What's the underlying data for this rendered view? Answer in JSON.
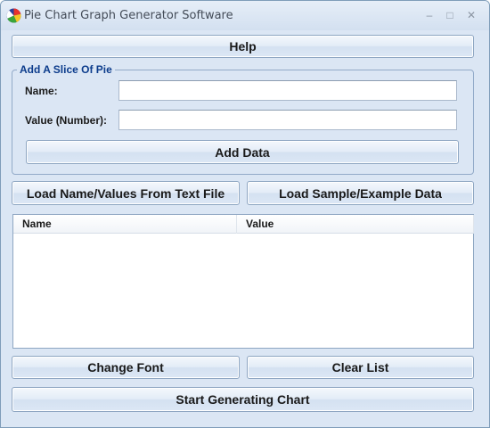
{
  "window": {
    "title": "Pie Chart Graph Generator Software",
    "controls": {
      "minimize": "–",
      "maximize": "□",
      "close": "✕"
    }
  },
  "buttons": {
    "help": "Help",
    "add_data": "Add Data",
    "load_file": "Load Name/Values From Text File",
    "load_sample": "Load Sample/Example Data",
    "change_font": "Change Font",
    "clear_list": "Clear List",
    "start": "Start Generating Chart"
  },
  "add_slice": {
    "legend": "Add A Slice Of Pie",
    "name_label": "Name:",
    "name_value": "",
    "value_label": "Value (Number):",
    "value_value": ""
  },
  "list": {
    "columns": [
      "Name",
      "Value"
    ],
    "rows": []
  }
}
